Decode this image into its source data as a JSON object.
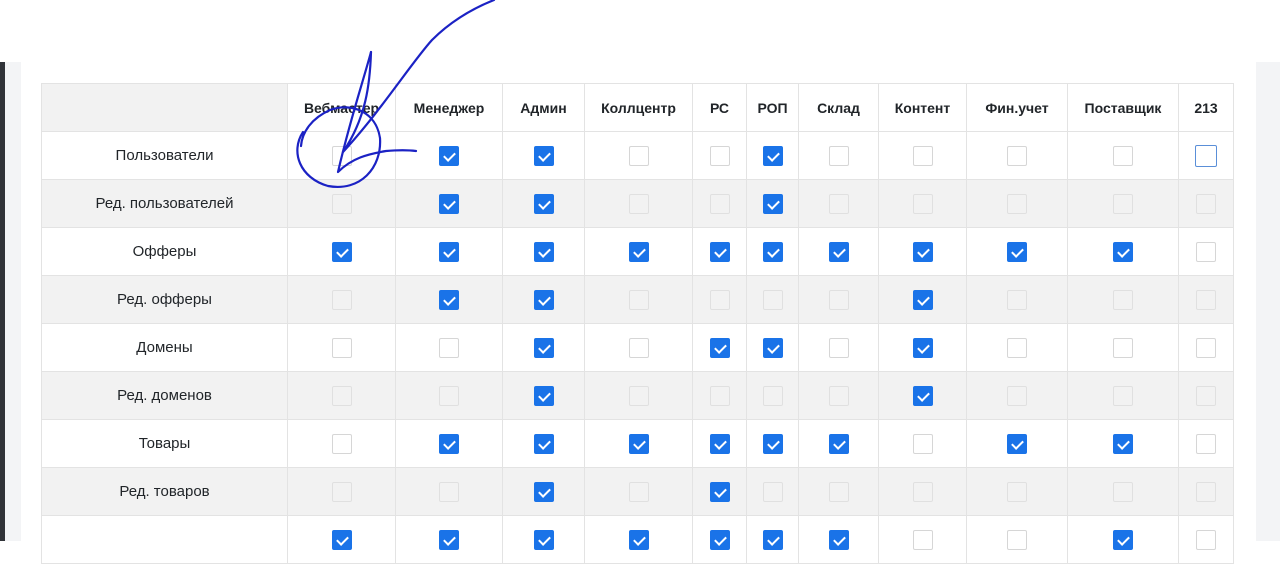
{
  "columns": [
    "Вебмастер",
    "Менеджер",
    "Админ",
    "Коллцентр",
    "РС",
    "РОП",
    "Склад",
    "Контент",
    "Фин.учет",
    "Поставщик",
    "213"
  ],
  "rows": [
    {
      "label": "Пользователи",
      "checks": [
        false,
        true,
        true,
        false,
        false,
        true,
        false,
        false,
        false,
        false,
        false
      ]
    },
    {
      "label": "Ред. пользователей",
      "checks": [
        false,
        true,
        true,
        false,
        false,
        true,
        false,
        false,
        false,
        false,
        false
      ]
    },
    {
      "label": "Офферы",
      "checks": [
        true,
        true,
        true,
        true,
        true,
        true,
        true,
        true,
        true,
        true,
        false
      ]
    },
    {
      "label": "Ред. офферы",
      "checks": [
        false,
        true,
        true,
        false,
        false,
        false,
        false,
        true,
        false,
        false,
        false
      ]
    },
    {
      "label": "Домены",
      "checks": [
        false,
        false,
        true,
        false,
        true,
        true,
        false,
        true,
        false,
        false,
        false
      ]
    },
    {
      "label": "Ред. доменов",
      "checks": [
        false,
        false,
        true,
        false,
        false,
        false,
        false,
        true,
        false,
        false,
        false
      ]
    },
    {
      "label": "Товары",
      "checks": [
        false,
        true,
        true,
        true,
        true,
        true,
        true,
        false,
        true,
        true,
        false
      ]
    },
    {
      "label": "Ред. товаров",
      "checks": [
        false,
        false,
        true,
        false,
        true,
        false,
        false,
        false,
        false,
        false,
        false
      ]
    },
    {
      "label": "",
      "checks": [
        true,
        true,
        true,
        true,
        true,
        true,
        true,
        false,
        false,
        true,
        false
      ]
    }
  ],
  "focused_cell": {
    "row": 0,
    "col": 10
  },
  "annotation_color": "#1b22c4",
  "accent_color": "#1a73e8"
}
